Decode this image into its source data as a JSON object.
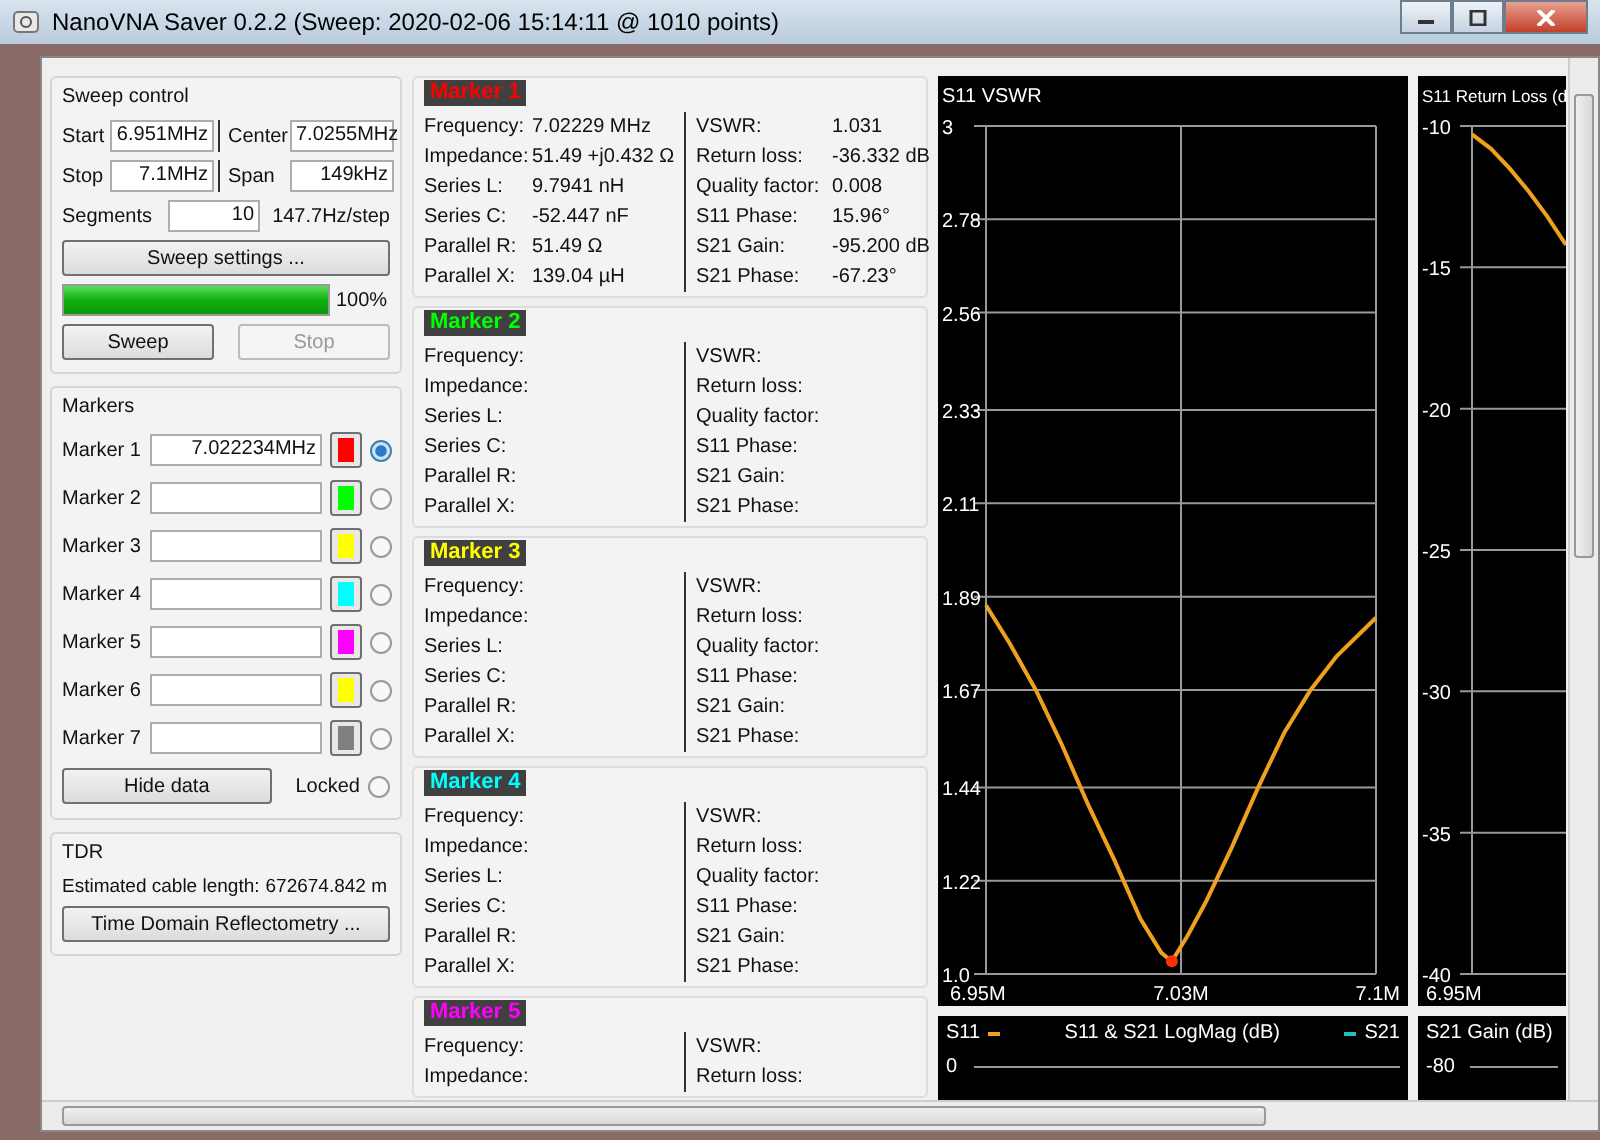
{
  "window": {
    "title": "NanoVNA Saver 0.2.2 (Sweep: 2020-02-06 15:14:11 @ 1010 points)"
  },
  "sweep_control": {
    "title": "Sweep control",
    "fields": [
      {
        "label": "Start",
        "value": "6.951MHz"
      },
      {
        "label": "Center",
        "value": "7.0255MHz"
      },
      {
        "label": "Stop",
        "value": "7.1MHz"
      },
      {
        "label": "Span",
        "value": "149kHz"
      }
    ],
    "segments": {
      "label": "Segments",
      "value": "10"
    },
    "step": "147.7Hz/step",
    "settings_button": "Sweep settings ...",
    "progress": {
      "level": 1,
      "reading": "100%"
    },
    "buttons": [
      {
        "label": "Sweep",
        "disabled": false
      },
      {
        "label": "Stop",
        "disabled": true
      }
    ]
  },
  "markers": {
    "title": "Markers",
    "items": [
      {
        "label": "Marker 1",
        "value": "7.022234MHz",
        "color": "#ff0000",
        "selected": true
      },
      {
        "label": "Marker 2",
        "color": "#00ff00",
        "selected": false
      },
      {
        "label": "Marker 3",
        "color": "#ffff00",
        "selected": false
      },
      {
        "label": "Marker 4",
        "color": "#00ffff",
        "selected": false
      },
      {
        "label": "Marker 5",
        "color": "#ff00ff",
        "selected": false
      },
      {
        "label": "Marker 6",
        "color": "#ffff00",
        "selected": false
      },
      {
        "label": "Marker 7",
        "color": "#808080",
        "selected": false
      }
    ],
    "hide_button": "Hide data",
    "locked": {
      "label": "Locked",
      "checked": false
    }
  },
  "tdr": {
    "title": "TDR",
    "label": "Estimated cable length:",
    "value": "672674.842 m",
    "button": "Time Domain Reflectometry ..."
  },
  "marker_details": [
    {
      "title": "Marker 1",
      "left": [
        {
          "label": "Frequency:",
          "value": "7.02229 MHz"
        },
        {
          "label": "Impedance:",
          "value": "51.49 +j0.432 Ω"
        },
        {
          "label": "Series L:",
          "value": "9.7941 nH"
        },
        {
          "label": "Series C:",
          "value": "-52.447 nF"
        },
        {
          "label": "Parallel R:",
          "value": "51.49 Ω"
        },
        {
          "label": "Parallel X:",
          "value": "139.04 µH"
        }
      ],
      "right": [
        {
          "label": "VSWR:",
          "value": "1.031"
        },
        {
          "label": "Return loss:",
          "value": "-36.332 dB"
        },
        {
          "label": "Quality factor:",
          "value": "0.008"
        },
        {
          "label": "S11 Phase:",
          "value": "15.96°"
        },
        {
          "label": "S21 Gain:",
          "value": "-95.200 dB"
        },
        {
          "label": "S21 Phase:",
          "value": "-67.23°"
        }
      ]
    },
    {
      "title": "Marker 2",
      "left": [
        {
          "label": "Frequency:"
        },
        {
          "label": "Impedance:"
        },
        {
          "label": "Series L:"
        },
        {
          "label": "Series C:"
        },
        {
          "label": "Parallel R:"
        },
        {
          "label": "Parallel X:"
        }
      ],
      "right": [
        {
          "label": "VSWR:"
        },
        {
          "label": "Return loss:"
        },
        {
          "label": "Quality factor:"
        },
        {
          "label": "S11 Phase:"
        },
        {
          "label": "S21 Gain:"
        },
        {
          "label": "S21 Phase:"
        }
      ]
    },
    {
      "title": "Marker 3",
      "left": [
        {
          "label": "Frequency:"
        },
        {
          "label": "Impedance:"
        },
        {
          "label": "Series L:"
        },
        {
          "label": "Series C:"
        },
        {
          "label": "Parallel R:"
        },
        {
          "label": "Parallel X:"
        }
      ],
      "right": [
        {
          "label": "VSWR:"
        },
        {
          "label": "Return loss:"
        },
        {
          "label": "Quality factor:"
        },
        {
          "label": "S11 Phase:"
        },
        {
          "label": "S21 Gain:"
        },
        {
          "label": "S21 Phase:"
        }
      ]
    },
    {
      "title": "Marker 4",
      "left": [
        {
          "label": "Frequency:"
        },
        {
          "label": "Impedance:"
        },
        {
          "label": "Series L:"
        },
        {
          "label": "Series C:"
        },
        {
          "label": "Parallel R:"
        },
        {
          "label": "Parallel X:"
        }
      ],
      "right": [
        {
          "label": "VSWR:"
        },
        {
          "label": "Return loss:"
        },
        {
          "label": "Quality factor:"
        },
        {
          "label": "S11 Phase:"
        },
        {
          "label": "S21 Gain:"
        },
        {
          "label": "S21 Phase:"
        }
      ]
    },
    {
      "title": "Marker 5",
      "left": [
        {
          "label": "Frequency:"
        },
        {
          "label": "Impedance:"
        }
      ],
      "right": [
        {
          "label": "VSWR:"
        },
        {
          "label": "Return loss:"
        }
      ]
    }
  ],
  "charts": [
    {
      "chart_data": {
        "type": "line",
        "title": "S11 VSWR",
        "x": [
          6.951,
          6.96,
          6.97,
          6.98,
          6.99,
          7.0,
          7.01,
          7.018,
          7.022,
          7.028,
          7.035,
          7.045,
          7.055,
          7.065,
          7.075,
          7.085,
          7.1
        ],
        "grid": true,
        "series": [
          {
            "color": "#f0a020",
            "values": [
              1.87,
              1.78,
              1.67,
              1.54,
              1.4,
              1.27,
              1.13,
              1.05,
              1.03,
              1.09,
              1.17,
              1.3,
              1.44,
              1.57,
              1.67,
              1.75,
              1.84
            ]
          }
        ],
        "xlim": [
          6.951,
          7.1
        ],
        "ylim": [
          1.0,
          3.0
        ],
        "xticks": [
          {
            "value": 6.951,
            "label": "6.95M"
          },
          {
            "value": 7.0255,
            "label": "7.03M"
          },
          {
            "value": 7.1,
            "label": "7.1M"
          }
        ],
        "yticks": [
          {
            "value": 3,
            "label": "3"
          },
          2.78,
          2.56,
          2.33,
          2.11,
          1.89,
          1.67,
          1.44,
          1.22,
          {
            "value": 1,
            "label": "1.0"
          }
        ]
      }
    },
    {
      "chart_data": {
        "type": "line",
        "title": "S11 Return Loss (d",
        "grid": true,
        "series": [
          {
            "color": "#f0a020",
            "values": [
              -10.3,
              -10.8,
              -11.5,
              -12.3,
              -13.2,
              -14.2
            ]
          }
        ],
        "ylim": [
          -40,
          -10
        ],
        "yticks": [
          -10,
          -15,
          -20,
          -25,
          -30,
          -35,
          -40
        ],
        "annotations": [
          {
            "text": "6.95M"
          }
        ]
      }
    }
  ],
  "bottom_charts": [
    {
      "title": "S11 & S21 LogMag (dB)",
      "legend": [
        {
          "label": "S11",
          "color": "#f0a020"
        },
        {
          "label": "S21",
          "color": "#20c0c0"
        }
      ],
      "tick": "0"
    },
    {
      "title": "S21 Gain (dB)",
      "tick": "-80"
    }
  ]
}
